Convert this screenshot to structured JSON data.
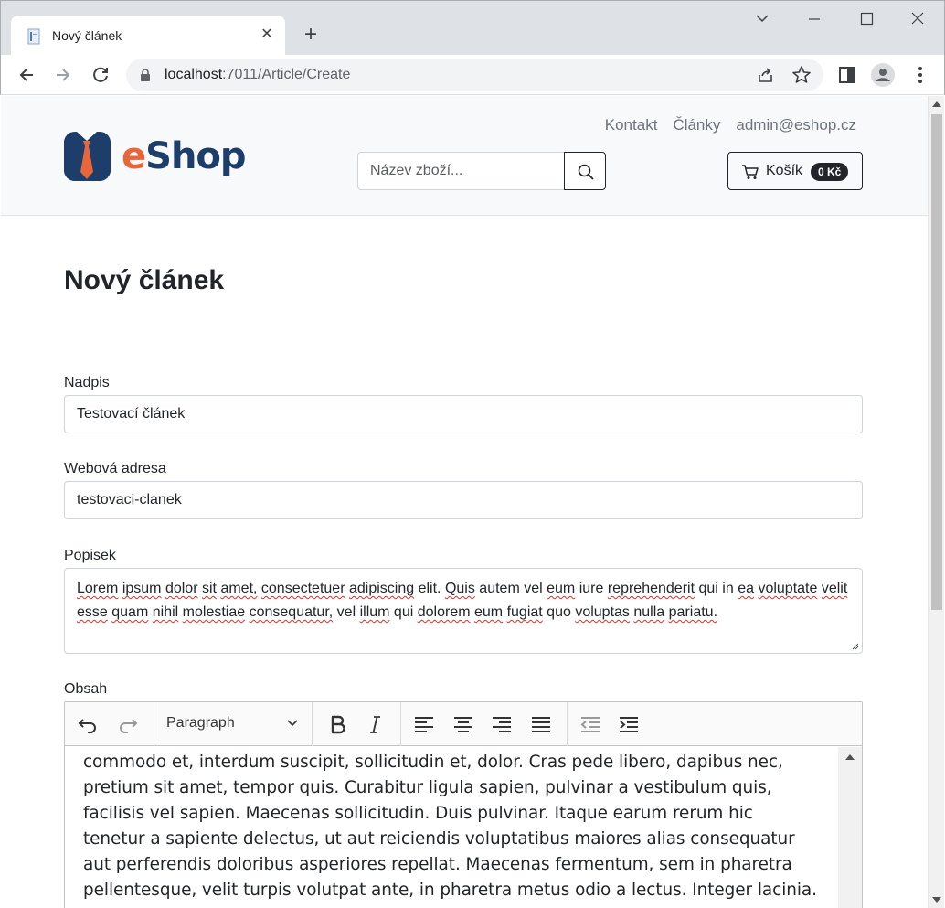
{
  "browser": {
    "tab_title": "Nový článek",
    "url_host": "localhost",
    "url_path": ":7011/Article/Create"
  },
  "site": {
    "logo_e": "e",
    "logo_shop": "Shop",
    "nav": [
      "Kontakt",
      "Články",
      "admin@eshop.cz"
    ],
    "search_placeholder": "Název zboží...",
    "cart_label": "Košík",
    "cart_total": "0 Kč"
  },
  "page": {
    "title": "Nový článek"
  },
  "form": {
    "title_label": "Nadpis",
    "title_value": "Testovací článek",
    "url_label": "Webová adresa",
    "url_value": "testovaci-clanek",
    "description_label": "Popisek",
    "description_value": "Lorem ipsum dolor sit amet, consectetuer adipiscing elit. Quis autem vel eum iure reprehenderit qui in ea voluptate velit esse quam nihil molestiae consequatur, vel illum qui dolorem eum fugiat quo voluptas nulla pariatu.",
    "content_label": "Obsah"
  },
  "editor": {
    "heading_select": "Paragraph",
    "content": "commodo et, interdum suscipit, sollicitudin et, dolor. Cras pede libero, dapibus nec, pretium sit amet, tempor quis. Curabitur ligula sapien, pulvinar a vestibulum quis, facilisis vel sapien. Maecenas sollicitudin. Duis pulvinar. Itaque earum rerum hic tenetur a sapiente delectus, ut aut reiciendis voluptatibus maiores alias consequatur aut perferendis doloribus asperiores repellat. Maecenas fermentum, sem in pharetra pellentesque, velit turpis volutpat ante, in pharetra metus odio a lectus. Integer lacinia. Ut tempus purus at lorem. Curabitur"
  },
  "colors": {
    "brand_orange": "#e8673a",
    "brand_navy": "#1d3e6b",
    "header_bg": "#f8f9fa"
  }
}
